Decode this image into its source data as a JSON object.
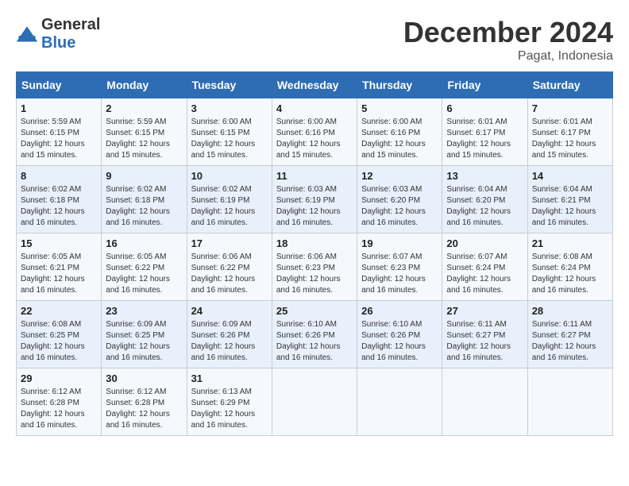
{
  "header": {
    "logo_general": "General",
    "logo_blue": "Blue",
    "month_year": "December 2024",
    "location": "Pagat, Indonesia"
  },
  "days_of_week": [
    "Sunday",
    "Monday",
    "Tuesday",
    "Wednesday",
    "Thursday",
    "Friday",
    "Saturday"
  ],
  "weeks": [
    [
      {
        "day": "1",
        "sunrise": "5:59 AM",
        "sunset": "6:15 PM",
        "daylight": "12 hours and 15 minutes."
      },
      {
        "day": "2",
        "sunrise": "5:59 AM",
        "sunset": "6:15 PM",
        "daylight": "12 hours and 15 minutes."
      },
      {
        "day": "3",
        "sunrise": "6:00 AM",
        "sunset": "6:15 PM",
        "daylight": "12 hours and 15 minutes."
      },
      {
        "day": "4",
        "sunrise": "6:00 AM",
        "sunset": "6:16 PM",
        "daylight": "12 hours and 15 minutes."
      },
      {
        "day": "5",
        "sunrise": "6:00 AM",
        "sunset": "6:16 PM",
        "daylight": "12 hours and 15 minutes."
      },
      {
        "day": "6",
        "sunrise": "6:01 AM",
        "sunset": "6:17 PM",
        "daylight": "12 hours and 15 minutes."
      },
      {
        "day": "7",
        "sunrise": "6:01 AM",
        "sunset": "6:17 PM",
        "daylight": "12 hours and 15 minutes."
      }
    ],
    [
      {
        "day": "8",
        "sunrise": "6:02 AM",
        "sunset": "6:18 PM",
        "daylight": "12 hours and 16 minutes."
      },
      {
        "day": "9",
        "sunrise": "6:02 AM",
        "sunset": "6:18 PM",
        "daylight": "12 hours and 16 minutes."
      },
      {
        "day": "10",
        "sunrise": "6:02 AM",
        "sunset": "6:19 PM",
        "daylight": "12 hours and 16 minutes."
      },
      {
        "day": "11",
        "sunrise": "6:03 AM",
        "sunset": "6:19 PM",
        "daylight": "12 hours and 16 minutes."
      },
      {
        "day": "12",
        "sunrise": "6:03 AM",
        "sunset": "6:20 PM",
        "daylight": "12 hours and 16 minutes."
      },
      {
        "day": "13",
        "sunrise": "6:04 AM",
        "sunset": "6:20 PM",
        "daylight": "12 hours and 16 minutes."
      },
      {
        "day": "14",
        "sunrise": "6:04 AM",
        "sunset": "6:21 PM",
        "daylight": "12 hours and 16 minutes."
      }
    ],
    [
      {
        "day": "15",
        "sunrise": "6:05 AM",
        "sunset": "6:21 PM",
        "daylight": "12 hours and 16 minutes."
      },
      {
        "day": "16",
        "sunrise": "6:05 AM",
        "sunset": "6:22 PM",
        "daylight": "12 hours and 16 minutes."
      },
      {
        "day": "17",
        "sunrise": "6:06 AM",
        "sunset": "6:22 PM",
        "daylight": "12 hours and 16 minutes."
      },
      {
        "day": "18",
        "sunrise": "6:06 AM",
        "sunset": "6:23 PM",
        "daylight": "12 hours and 16 minutes."
      },
      {
        "day": "19",
        "sunrise": "6:07 AM",
        "sunset": "6:23 PM",
        "daylight": "12 hours and 16 minutes."
      },
      {
        "day": "20",
        "sunrise": "6:07 AM",
        "sunset": "6:24 PM",
        "daylight": "12 hours and 16 minutes."
      },
      {
        "day": "21",
        "sunrise": "6:08 AM",
        "sunset": "6:24 PM",
        "daylight": "12 hours and 16 minutes."
      }
    ],
    [
      {
        "day": "22",
        "sunrise": "6:08 AM",
        "sunset": "6:25 PM",
        "daylight": "12 hours and 16 minutes."
      },
      {
        "day": "23",
        "sunrise": "6:09 AM",
        "sunset": "6:25 PM",
        "daylight": "12 hours and 16 minutes."
      },
      {
        "day": "24",
        "sunrise": "6:09 AM",
        "sunset": "6:26 PM",
        "daylight": "12 hours and 16 minutes."
      },
      {
        "day": "25",
        "sunrise": "6:10 AM",
        "sunset": "6:26 PM",
        "daylight": "12 hours and 16 minutes."
      },
      {
        "day": "26",
        "sunrise": "6:10 AM",
        "sunset": "6:26 PM",
        "daylight": "12 hours and 16 minutes."
      },
      {
        "day": "27",
        "sunrise": "6:11 AM",
        "sunset": "6:27 PM",
        "daylight": "12 hours and 16 minutes."
      },
      {
        "day": "28",
        "sunrise": "6:11 AM",
        "sunset": "6:27 PM",
        "daylight": "12 hours and 16 minutes."
      }
    ],
    [
      {
        "day": "29",
        "sunrise": "6:12 AM",
        "sunset": "6:28 PM",
        "daylight": "12 hours and 16 minutes."
      },
      {
        "day": "30",
        "sunrise": "6:12 AM",
        "sunset": "6:28 PM",
        "daylight": "12 hours and 16 minutes."
      },
      {
        "day": "31",
        "sunrise": "6:13 AM",
        "sunset": "6:29 PM",
        "daylight": "12 hours and 16 minutes."
      },
      null,
      null,
      null,
      null
    ]
  ],
  "labels": {
    "sunrise_prefix": "Sunrise: ",
    "sunset_prefix": "Sunset: ",
    "daylight_prefix": "Daylight: "
  }
}
